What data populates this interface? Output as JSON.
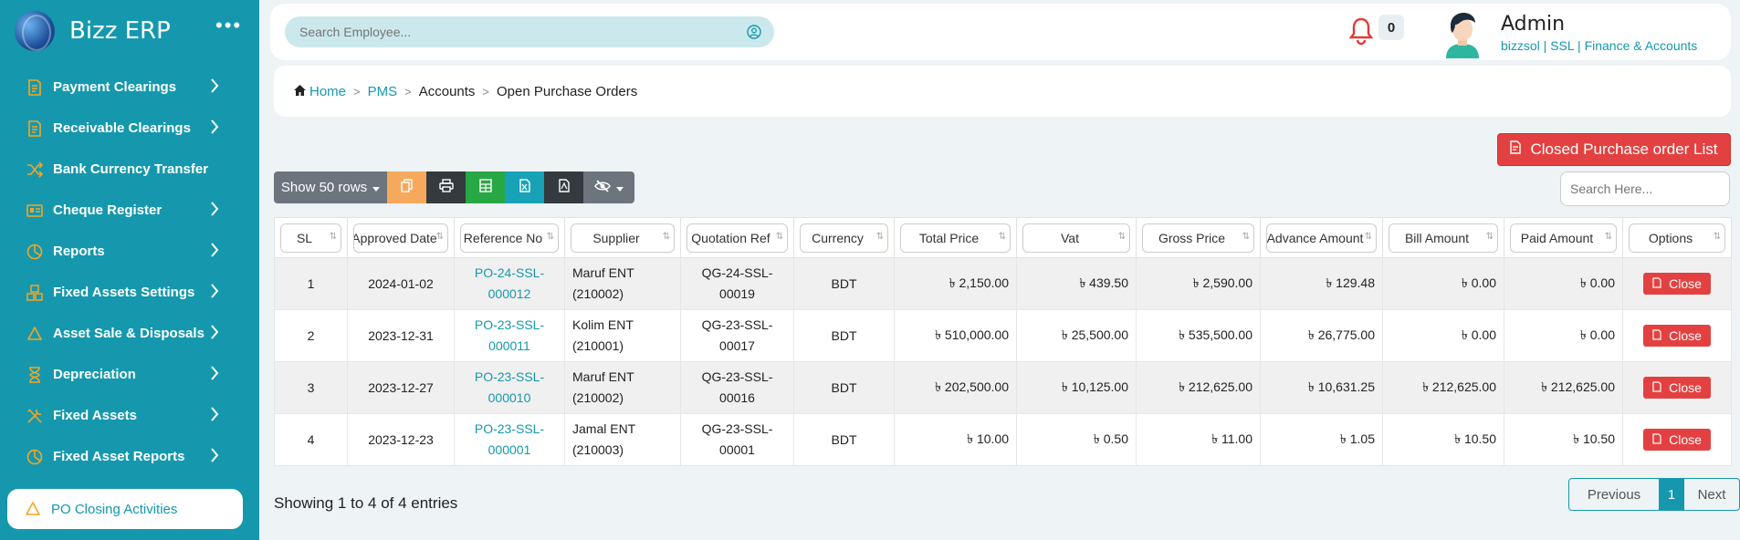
{
  "app": {
    "name": "Bizz ERP",
    "more": "•••"
  },
  "sidebar": {
    "items": [
      {
        "label": "Payment Clearings",
        "icon": "receipt-icon",
        "chevron": true
      },
      {
        "label": "Receivable Clearings",
        "icon": "receipt-icon",
        "chevron": true
      },
      {
        "label": "Bank Currency Transfer",
        "icon": "shuffle-icon",
        "chevron": false
      },
      {
        "label": "Cheque Register",
        "icon": "id-card-icon",
        "chevron": true
      },
      {
        "label": "Reports",
        "icon": "pie-chart-icon",
        "chevron": true
      },
      {
        "label": "Fixed Assets Settings",
        "icon": "boxes-icon",
        "chevron": true
      },
      {
        "label": "Asset Sale & Disposals",
        "icon": "recycle-icon",
        "chevron": true
      },
      {
        "label": "Depreciation",
        "icon": "hourglass-icon",
        "chevron": true
      },
      {
        "label": "Fixed Assets",
        "icon": "tools-icon",
        "chevron": true
      },
      {
        "label": "Fixed Asset Reports",
        "icon": "pie-chart-icon",
        "chevron": true
      }
    ],
    "active": {
      "label": "PO Closing Activities",
      "icon": "recycle-icon"
    }
  },
  "topbar": {
    "search_placeholder": "Search Employee...",
    "notifications": "0",
    "user_name": "Admin",
    "user_sub": "bizzsol | SSL  | Finance & Accounts"
  },
  "breadcrumb": {
    "home": "Home",
    "pms": "PMS",
    "accounts": "Accounts",
    "current": "Open Purchase Orders"
  },
  "actions": {
    "closed_list": "Closed Purchase order List",
    "show_rows": "Show 50 rows",
    "search_placeholder": "Search Here..."
  },
  "table": {
    "columns": [
      "SL",
      "Approved Date",
      "Reference No",
      "Supplier",
      "Quotation Ref",
      "Currency",
      "Total Price",
      "Vat",
      "Gross Price",
      "Advance Amount",
      "Bill Amount",
      "Paid Amount",
      "Options"
    ],
    "rows": [
      {
        "sl": "1",
        "date": "2024-01-02",
        "ref1": "PO-24-SSL-",
        "ref2": "000012",
        "sup1": "Maruf ENT",
        "sup2": "(210002)",
        "q1": "QG-24-SSL-",
        "q2": "00019",
        "cur": "BDT",
        "total": "৳ 2,150.00",
        "vat": "৳ 439.50",
        "gross": "৳ 2,590.00",
        "adv": "৳ 129.48",
        "bill": "৳ 0.00",
        "paid": "৳ 0.00",
        "opt": "Close"
      },
      {
        "sl": "2",
        "date": "2023-12-31",
        "ref1": "PO-23-SSL-",
        "ref2": "000011",
        "sup1": "Kolim ENT",
        "sup2": "(210001)",
        "q1": "QG-23-SSL-",
        "q2": "00017",
        "cur": "BDT",
        "total": "৳ 510,000.00",
        "vat": "৳ 25,500.00",
        "gross": "৳ 535,500.00",
        "adv": "৳ 26,775.00",
        "bill": "৳ 0.00",
        "paid": "৳ 0.00",
        "opt": "Close"
      },
      {
        "sl": "3",
        "date": "2023-12-27",
        "ref1": "PO-23-SSL-",
        "ref2": "000010",
        "sup1": "Maruf ENT",
        "sup2": "(210002)",
        "q1": "QG-23-SSL-",
        "q2": "00016",
        "cur": "BDT",
        "total": "৳ 202,500.00",
        "vat": "৳ 10,125.00",
        "gross": "৳ 212,625.00",
        "adv": "৳ 10,631.25",
        "bill": "৳ 212,625.00",
        "paid": "৳ 212,625.00",
        "opt": "Close"
      },
      {
        "sl": "4",
        "date": "2023-12-23",
        "ref1": "PO-23-SSL-",
        "ref2": "000001",
        "sup1": "Jamal ENT",
        "sup2": "(210003)",
        "q1": "QG-23-SSL-",
        "q2": "00001",
        "cur": "BDT",
        "total": "৳ 10.00",
        "vat": "৳ 0.50",
        "gross": "৳ 11.00",
        "adv": "৳ 1.05",
        "bill": "৳ 10.50",
        "paid": "৳ 10.50",
        "opt": "Close"
      }
    ]
  },
  "footer": {
    "info": "Showing 1 to 4 of 4 entries",
    "prev": "Previous",
    "page": "1",
    "next": "Next"
  },
  "colors": {
    "sidebar": "#1598ad",
    "accent": "#1598ad",
    "danger": "#e34141",
    "icon_orange": "#f6a623"
  }
}
